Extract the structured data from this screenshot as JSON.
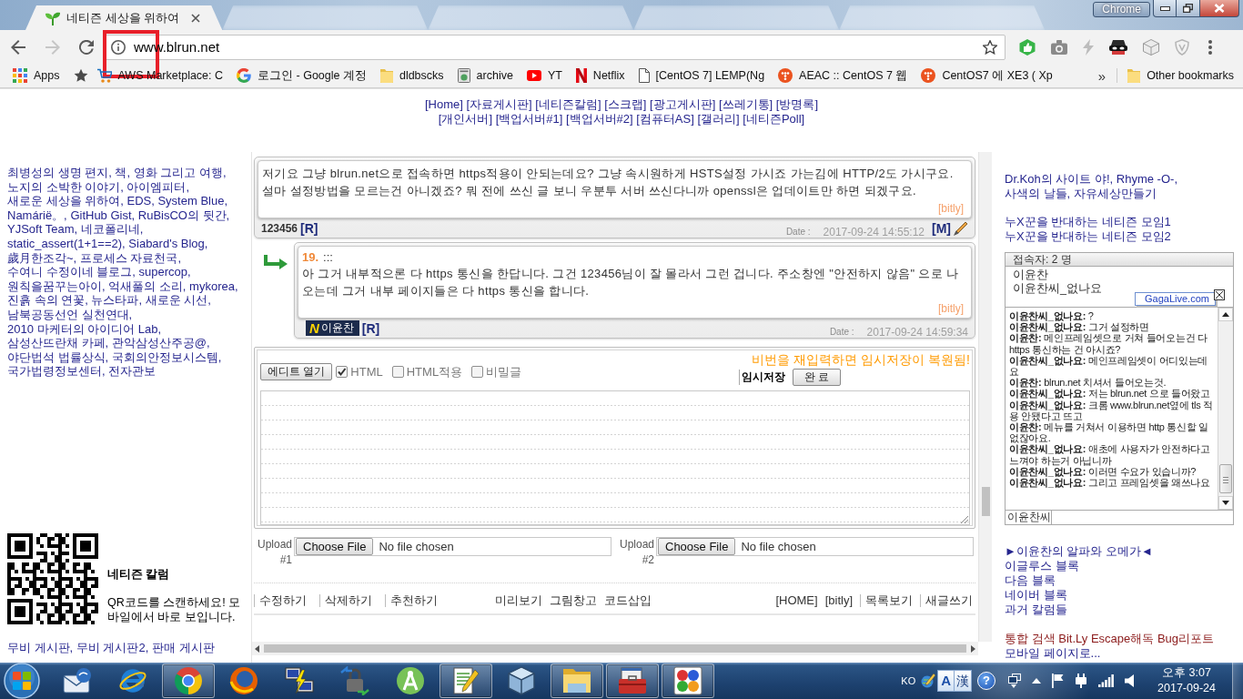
{
  "annotation": {
    "kind": "rectangle"
  },
  "browser": {
    "tabs": [
      {
        "title": "네티즌 세상을 위하여",
        "selected": true
      },
      {
        "selected": false
      },
      {
        "selected": false
      },
      {
        "selected": false
      },
      {
        "selected": false
      }
    ],
    "profile": "Chrome",
    "forward_disabled": true,
    "address": "www.blrun.net",
    "bookmarks": [
      {
        "kind": "apps",
        "label": "Apps"
      },
      {
        "kind": "site"
      },
      {
        "kind": "site",
        "label": "AWS Marketplace: C"
      },
      {
        "kind": "site",
        "label": "로그인 - Google 계정"
      },
      {
        "kind": "folder",
        "label": "dldbscks"
      },
      {
        "kind": "site",
        "label": "archive"
      },
      {
        "kind": "site",
        "label": "YT"
      },
      {
        "kind": "site",
        "label": "Netflix"
      },
      {
        "kind": "site",
        "label": "[CentOS 7] LEMP(Ng"
      },
      {
        "kind": "site",
        "label": "AEAC :: CentOS 7 웹"
      },
      {
        "kind": "site",
        "label": "CentOS7 에 XE3 ( Xp"
      }
    ],
    "overflow": "»",
    "other_bookmarks": "Other bookmarks"
  },
  "nav": {
    "rows": [
      [
        "[Home]",
        "[자료게시판]",
        "[네티즌칼럼]",
        "[스크랩]",
        "[광고게시판]",
        "[쓰레기통]",
        "[방명록]"
      ],
      [
        "[개인서버]",
        "[백업서버#1]",
        "[백업서버#2]",
        "[컴퓨터AS]",
        "[갤러리]",
        "[네티즌Poll]"
      ]
    ]
  },
  "left": {
    "links": [
      "최병성의 생명 편지,",
      "책, 영화 그리고 여행,",
      "노지의 소박한 이야기,",
      "아이엠피터,",
      "새로운 세상을 위하여,",
      "EDS,",
      "System Blue,",
      "Namárië。,",
      "GitHub Gist,",
      "RuBisCO의 뒷간,",
      "YJSoft Team,",
      "네코폴리네,",
      "static_assert(1+1==2),",
      "Siabard's Blog,",
      "歲月한조각~,",
      "프로세스 자료천국,",
      "수여니 수정이네 블로그,",
      "supercop,",
      "원칙을꿈꾸는아이,",
      "억새풀의 소리,",
      "mykorea,",
      "진흙 속의 연꽃,",
      "뉴스타파,",
      "새로운 시선,",
      "남북공동선언 실천연대,",
      "2010 마케터의 아이디어 Lab,",
      "삼성산뜨란채 카페,",
      "관악삼성산주공@,",
      "야단법석 법률상식,",
      "국회의안정보시스템,",
      "국가법령정보센터,",
      "전자관보"
    ],
    "qr": {
      "title": "네티즌 칼럼",
      "caption": "QR코드를 스캔하세요! 모바일에서 바로 보입니다."
    },
    "bottom_links": [
      "무비 게시판,",
      "무비 게시판2,",
      "판매 게시판"
    ]
  },
  "main": {
    "posts": [
      {
        "kind": "post",
        "text": "저기요 그냥 blrun.net으로 접속하면 https적용이 안되는데요? 그냥 속시원하게 HSTS설정 가시죠 가는김에 HTTP/2도 가시구요. 설마 설정방법을 모르는건 아니겠죠? 뭐 전에 쓰신 글 보니 우분투 서버 쓰신다니까 openssl은 업데이트만 하면 되겠구요.",
        "link": "[bitly]",
        "author": "123456",
        "reply_tag": "[R]",
        "date_label": "Date :",
        "date": "2017-09-24 14:55:12",
        "modify_tag": "[M]"
      },
      {
        "kind": "reply",
        "number": "19.",
        "title": ":::",
        "text": "아 그거 내부적으론 다 https 통신을 한답니다. 그건 123456님이 잘 몰라서 그런 겁니다. 주소창엔 \"안전하지 않음\" 으로 나오는데 그거 내부 페이지들은 다 https 통신을 합니다.",
        "link": "[bitly]",
        "rank": "N",
        "author": "이윤찬",
        "reply_tag": "[R]",
        "date_label": "Date :",
        "date": "2017-09-24 14:59:34"
      }
    ],
    "editor": {
      "open_button": "에디트 열기",
      "options": [
        {
          "label": "HTML",
          "checked": true
        },
        {
          "label": "HTML적용",
          "checked": false
        },
        {
          "label": "비밀글",
          "checked": false
        }
      ],
      "notice": "비번을 재입력하면 임시저장이 복원됨!",
      "autosave_label": "임시저장",
      "done_button": "완 료"
    },
    "uploads": [
      {
        "label": "Upload #1",
        "button": "Choose File",
        "status": "No file chosen"
      },
      {
        "label": "Upload #2",
        "button": "Choose File",
        "status": "No file chosen"
      }
    ],
    "actions": {
      "left": [
        "수정하기",
        "삭제하기",
        "추천하기"
      ],
      "center": [
        "미리보기",
        "그림창고",
        "코드삽입"
      ],
      "right": [
        "[HOME]",
        "[bitly]",
        "목록보기",
        "새글쓰기"
      ]
    }
  },
  "right": {
    "links": [
      "Dr.Koh의 사이트 야!,",
      "Rhyme -O-,",
      "사색의 날들,",
      "자유세상만들기"
    ],
    "group_links": [
      "누X꾼을 반대하는 네티즌 모임1",
      "누X꾼을 반대하는 네티즌 모임2"
    ],
    "chat": {
      "header": "접속자: 2 명",
      "users": [
        "이윤찬",
        "이윤찬씨_없나요"
      ],
      "badge": "GagaLive.com",
      "messages": [
        "**이윤찬씨_없나요:** ?",
        "**이윤찬씨_없나요:** 그거 설정하면",
        "**이윤찬:** 메인프레임셋으로 거쳐 들어오는건 다 https 통신하는 건 아시죠?",
        "**이윤찬씨_없나요:** 메인프레임셋이 어디있는데요",
        "**이윤찬:** blrun.net 치셔서 들어오는것.",
        "**이윤찬씨_없나요:** 저는 blrun.net 으로 들어왔고",
        "**이윤찬씨_없나요:** 크롬 www.blrun.net옆에 tls 적용 안됐다고 뜨고",
        "**이윤찬:** 메뉴를 거쳐서 이용하면 http 통신할 일 없잖아요.",
        "**이윤찬씨_없나요:** 애초에 사용자가 안전하다고 느껴야 하는거 아닙니까",
        "**이윤찬씨_없나요:** 이러면 수요가 있습니까?",
        "**이윤찬씨_없나요:** 그리고 프레임셋을 왜쓰나요"
      ],
      "name_value": "이윤찬씨"
    },
    "blog_links": [
      "►이윤찬의 알파와 오메가◄",
      "이글루스 블록",
      "다음 블록",
      "네이버 블록",
      "과거 칼럼들"
    ],
    "tool_links": [
      "통합 검색",
      "Bit.Ly Escape해독",
      "Bug리포트"
    ],
    "mobile_link": "모바일 페이지로..."
  },
  "taskbar": {
    "apps": [
      {
        "running": false
      },
      {
        "running": false
      },
      {
        "running": true
      },
      {
        "running": false
      },
      {
        "running": false
      },
      {
        "running": false
      },
      {
        "running": false
      },
      {
        "running": true
      },
      {
        "running": false
      },
      {
        "running": true
      },
      {
        "running": true
      },
      {
        "running": true
      }
    ],
    "tray": {
      "language": "KO",
      "input_mode": "A",
      "hanja": "漢",
      "help": "?",
      "time": "오후 3:07",
      "date": "2017-09-24"
    }
  }
}
